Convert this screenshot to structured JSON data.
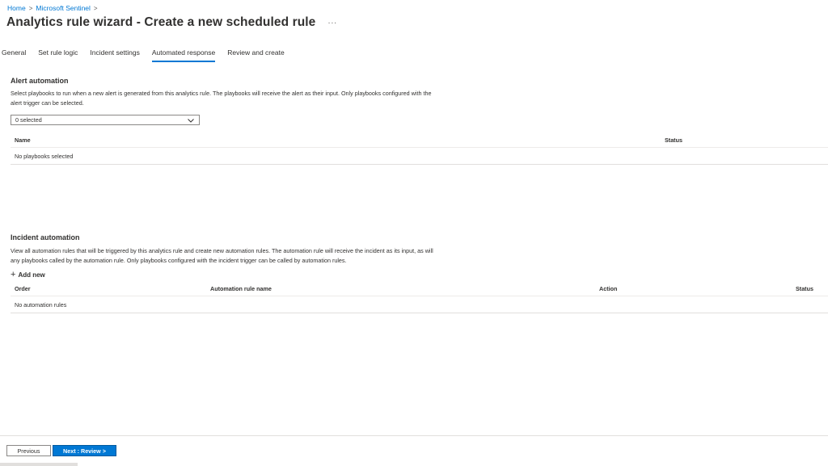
{
  "breadcrumb": [
    {
      "label": "Home"
    },
    {
      "label": "Microsoft Sentinel"
    }
  ],
  "breadcrumb_separator": ">",
  "page_title": "Analytics rule wizard - Create a new scheduled rule",
  "more_label": "···",
  "tabs": [
    {
      "label": "General"
    },
    {
      "label": "Set rule logic"
    },
    {
      "label": "Incident settings"
    },
    {
      "label": "Automated response",
      "active": true
    },
    {
      "label": "Review and create"
    }
  ],
  "alert_automation": {
    "title": "Alert automation",
    "description": "Select playbooks to run when a new alert is generated from this analytics rule. The playbooks will receive the alert as their input. Only playbooks configured with the alert trigger can be selected.",
    "dropdown_value": "0 selected",
    "columns": [
      "Name",
      "Status"
    ],
    "empty_text": "No playbooks selected"
  },
  "incident_automation": {
    "title": "Incident automation",
    "description": "View all automation rules that will be triggered by this analytics rule and create new automation rules. The automation rule will receive the incident as its input, as will any playbooks called by the automation rule. Only playbooks configured with the incident trigger can be called by automation rules.",
    "add_new_label": "Add new",
    "columns": [
      "Order",
      "Automation rule name",
      "Action",
      "Status"
    ],
    "empty_text": "No automation rules"
  },
  "footer": {
    "previous_label": "Previous",
    "next_label": "Next : Review >"
  },
  "colors": {
    "accent": "#0078d4",
    "text": "#323130",
    "border": "#e1dfdd"
  }
}
